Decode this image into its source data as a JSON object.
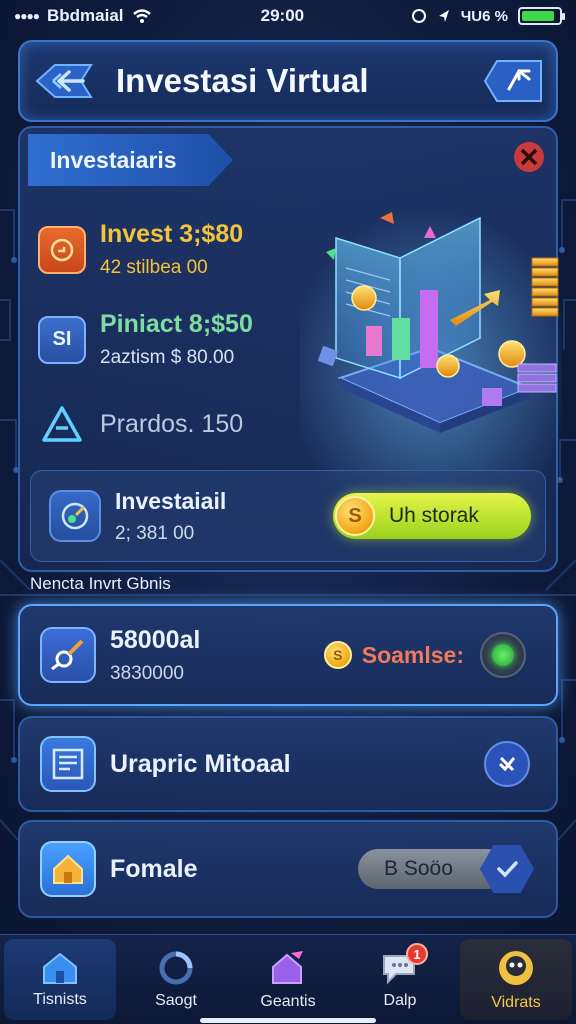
{
  "status_bar": {
    "carrier": "Bbdmaial",
    "time": "29:00",
    "right_text": "ЧU6 %"
  },
  "header": {
    "title": "Investasi Virtual",
    "back_icon": "back-arrow-icon",
    "share_icon": "share-icon"
  },
  "main_card": {
    "tag_label": "Investaiaris",
    "stats": [
      {
        "title": "Invest 3;$80",
        "sub": "42 stilbea 00",
        "title_color": "#f3c43a",
        "sub_color": "#f3c43a",
        "icon": "coin-box-icon",
        "icon_text": "G"
      },
      {
        "title": "Piniact 8;$50",
        "sub": "2aztism  $ 80.00",
        "title_color": "#7fdca0",
        "sub_color": "#d8e2f2",
        "icon": "chart-s-icon",
        "icon_text": "SI"
      },
      {
        "title": "Prardos. 150",
        "sub": "",
        "title_color": "#b9c9e2",
        "sub_color": "#d8e2f2",
        "icon": "triangle-icon",
        "icon_text": ""
      }
    ],
    "invest_panel": {
      "title": "Investaiail",
      "sub": "2; 381 00",
      "button_label": "Uh storak",
      "coin_symbol": "S"
    }
  },
  "section_label": "Nencta Invrt Gbnis",
  "list": [
    {
      "title": "58000al",
      "sub": "3830000",
      "right_text": "Soamlse:",
      "icon": "chart-pen-icon",
      "active": true
    },
    {
      "title": "Urapric Mitoaal",
      "sub": "",
      "right_text": "",
      "icon": "document-list-icon",
      "active": false
    },
    {
      "title": "Fomale",
      "sub": "",
      "right_text": "B Soöo",
      "icon": "home-icon",
      "active": false
    }
  ],
  "nav": [
    {
      "label": "Tisnists",
      "icon": "home-icon"
    },
    {
      "label": "Saogt",
      "icon": "search-icon"
    },
    {
      "label": "Geantis",
      "icon": "house-flag-icon"
    },
    {
      "label": "Dalp",
      "icon": "chat-icon",
      "badge": "1"
    },
    {
      "label": "Vidrats",
      "icon": "profile-icon"
    }
  ]
}
